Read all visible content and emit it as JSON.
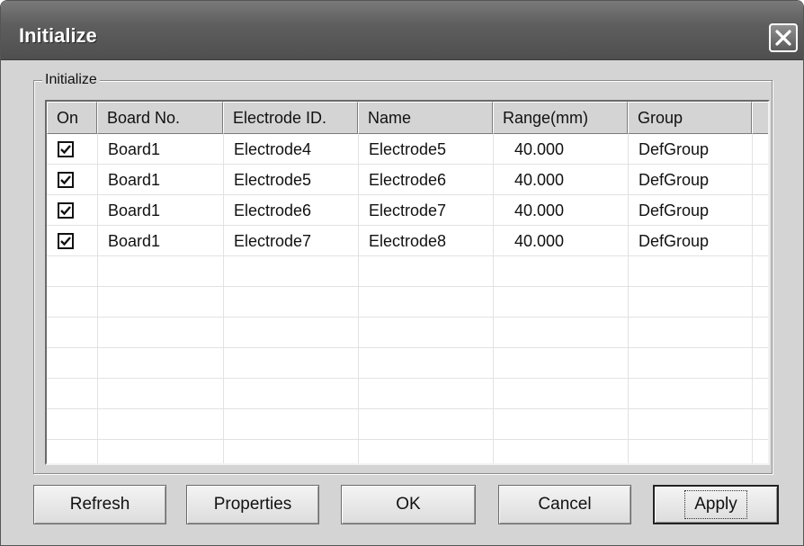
{
  "window": {
    "title": "Initialize"
  },
  "group": {
    "label": "Initialize"
  },
  "table": {
    "columns": [
      "On",
      "Board No.",
      "Electrode ID.",
      "Name",
      "Range(mm)",
      "Group"
    ],
    "rows": [
      {
        "checked": true,
        "board": "Board1",
        "electrode": "Electrode4",
        "name": "Electrode5",
        "range": "40.000",
        "group": "DefGroup"
      },
      {
        "checked": true,
        "board": "Board1",
        "electrode": "Electrode5",
        "name": "Electrode6",
        "range": "40.000",
        "group": "DefGroup"
      },
      {
        "checked": true,
        "board": "Board1",
        "electrode": "Electrode6",
        "name": "Electrode7",
        "range": "40.000",
        "group": "DefGroup"
      },
      {
        "checked": true,
        "board": "Board1",
        "electrode": "Electrode7",
        "name": "Electrode8",
        "range": "40.000",
        "group": "DefGroup"
      }
    ]
  },
  "buttons": {
    "refresh": "Refresh",
    "properties": "Properties",
    "ok": "OK",
    "cancel": "Cancel",
    "apply": "Apply"
  },
  "icons": {
    "close": "close-icon",
    "checkbox_checked": "checkmark-icon"
  }
}
